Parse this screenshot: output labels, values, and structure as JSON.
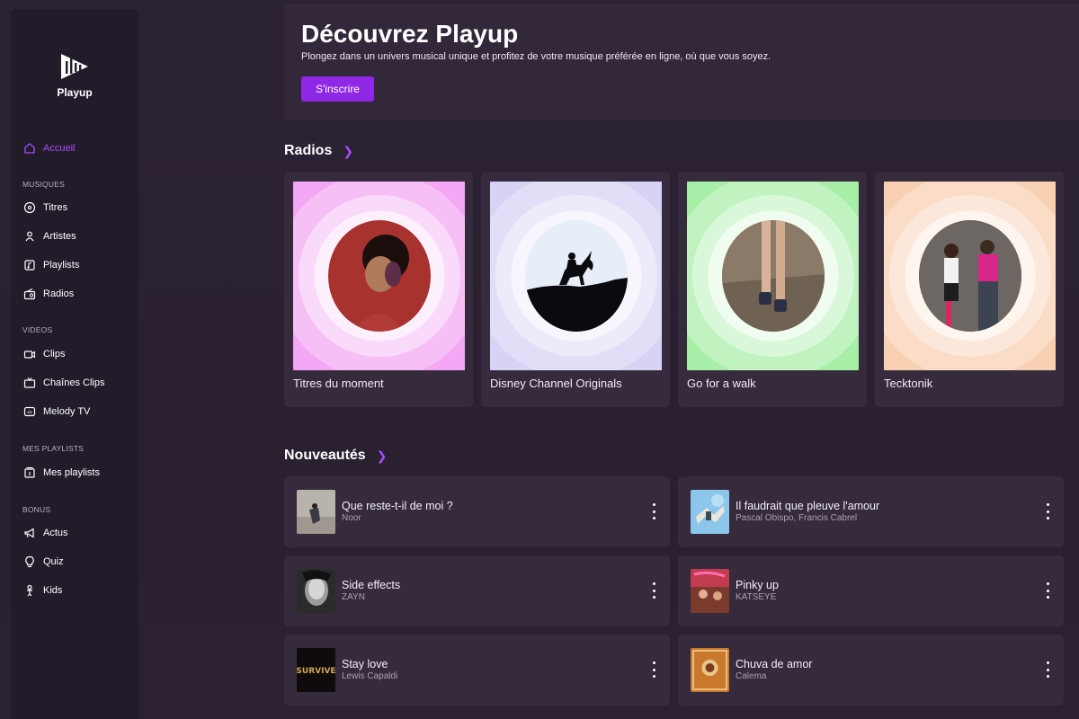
{
  "app": {
    "name": "Playup"
  },
  "sidebar": {
    "home": {
      "label": "Accueil",
      "icon": "home-icon"
    },
    "sections": [
      {
        "title": "MUSIQUES",
        "items": [
          {
            "label": "Titres",
            "icon": "disc-icon"
          },
          {
            "label": "Artistes",
            "icon": "artist-icon"
          },
          {
            "label": "Playlists",
            "icon": "playlist-icon"
          },
          {
            "label": "Radios",
            "icon": "radio-icon"
          }
        ]
      },
      {
        "title": "VIDEOS",
        "items": [
          {
            "label": "Clips",
            "icon": "video-camera-icon"
          },
          {
            "label": "Chaînes Clips",
            "icon": "tv-icon"
          },
          {
            "label": "Melody TV",
            "icon": "melody-tv-icon"
          }
        ]
      },
      {
        "title": "MES PLAYLISTS",
        "items": [
          {
            "label": "Mes playlists",
            "icon": "my-playlist-icon"
          }
        ]
      },
      {
        "title": "BONUS",
        "items": [
          {
            "label": "Actus",
            "icon": "megaphone-icon"
          },
          {
            "label": "Quiz",
            "icon": "lightbulb-icon"
          },
          {
            "label": "Kids",
            "icon": "kids-icon"
          }
        ]
      }
    ]
  },
  "hero": {
    "title": "Découvrez Playup",
    "subtitle": "Plongez dans un univers musical unique et profitez de votre musique préférée en ligne, où que vous soyez.",
    "cta": "S'inscrire"
  },
  "radios": {
    "title": "Radios",
    "items": [
      {
        "label": "Titres du moment",
        "color": "#f08ff2"
      },
      {
        "label": "Disney Channel Originals",
        "color": "#c9c6f2"
      },
      {
        "label": "Go for a walk",
        "color": "#8fea8f"
      },
      {
        "label": "Tecktonik",
        "color": "#f6c39e"
      }
    ]
  },
  "new_releases": {
    "title": "Nouveautés",
    "items": [
      {
        "title": "Que reste-t-il de moi ?",
        "artist": "Noor"
      },
      {
        "title": "Il faudrait que pleuve l'amour",
        "artist": "Pascal Obispo, Francis Cabrel"
      },
      {
        "title": "Side effects",
        "artist": "ZAYN"
      },
      {
        "title": "Pinky up",
        "artist": "KATSEYE"
      },
      {
        "title": "Stay love",
        "artist": "Lewis Capaldi",
        "cover_text": "SURVIVE"
      },
      {
        "title": "Chuva de amor",
        "artist": "Calema"
      }
    ]
  },
  "colors": {
    "accent": "#8f27e6",
    "active_nav": "#a64dff"
  }
}
